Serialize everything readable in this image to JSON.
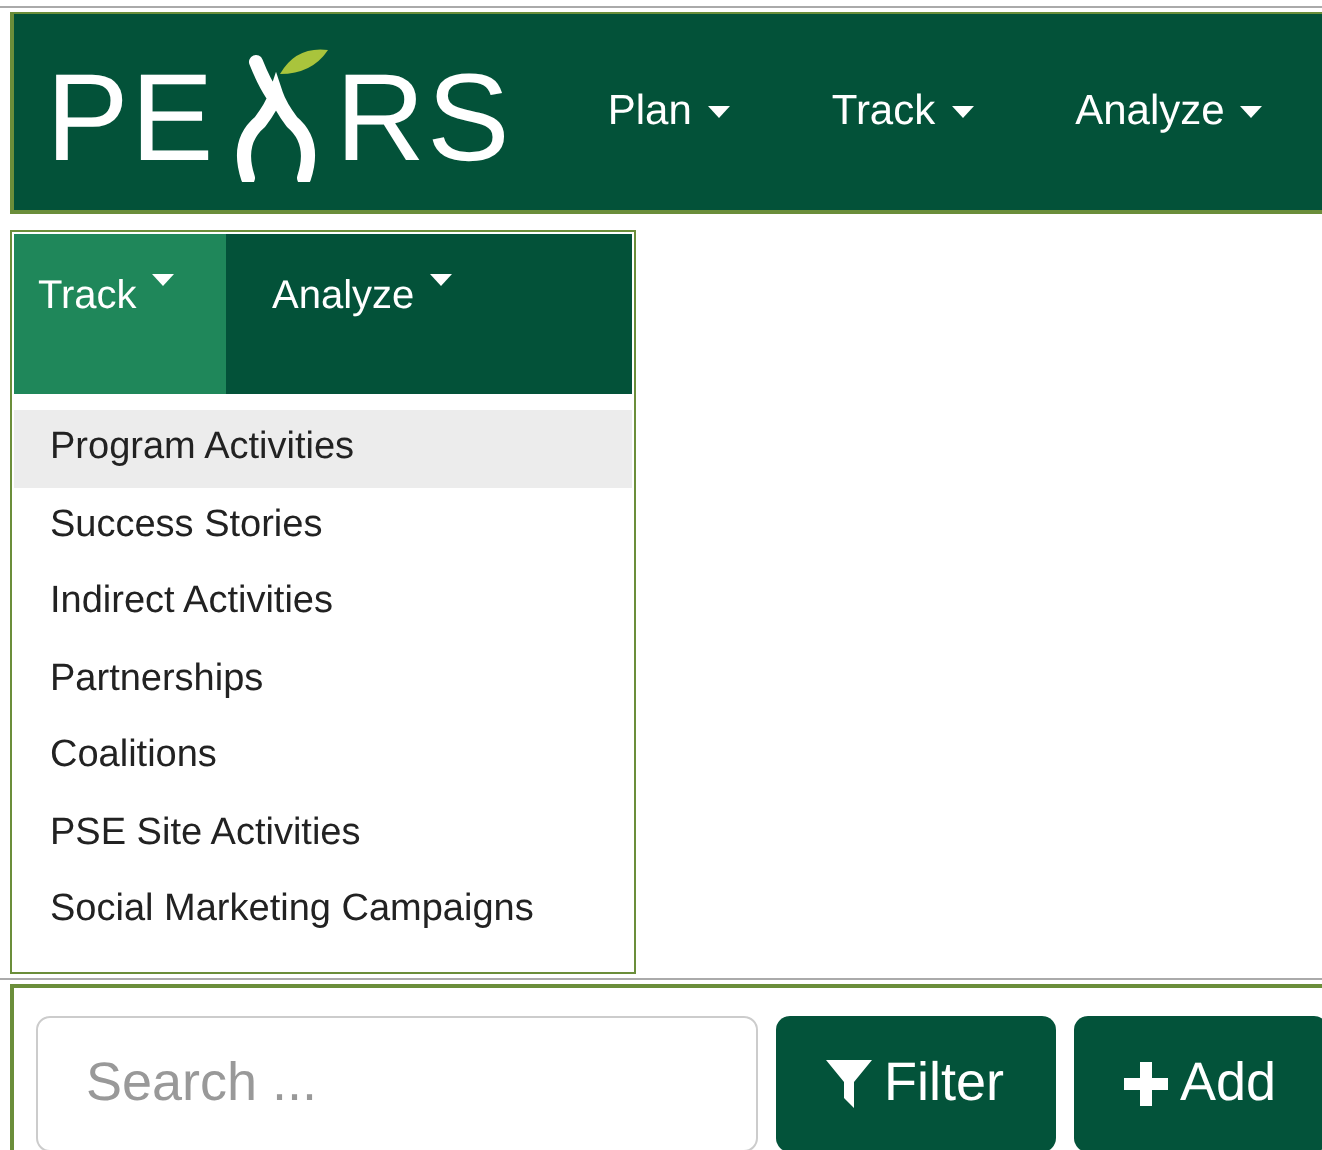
{
  "header": {
    "logo": {
      "left": "PE",
      "right": "RS"
    },
    "nav": [
      {
        "label": "Plan"
      },
      {
        "label": "Track"
      },
      {
        "label": "Analyze"
      }
    ]
  },
  "menu_panel": {
    "tabs": [
      {
        "label": "Track",
        "selected": true
      },
      {
        "label": "Analyze",
        "selected": false
      }
    ],
    "items": [
      {
        "label": "Program Activities",
        "highlighted": true
      },
      {
        "label": "Success Stories",
        "highlighted": false
      },
      {
        "label": "Indirect Activities",
        "highlighted": false
      },
      {
        "label": "Partnerships",
        "highlighted": false
      },
      {
        "label": "Coalitions",
        "highlighted": false
      },
      {
        "label": "PSE Site Activities",
        "highlighted": false
      },
      {
        "label": "Social Marketing Campaigns",
        "highlighted": false
      }
    ]
  },
  "toolbar": {
    "search": {
      "placeholder": "Search ..."
    },
    "buttons": [
      {
        "kind": "filter",
        "label": "Filter"
      },
      {
        "kind": "add",
        "label": "Add"
      }
    ]
  }
}
